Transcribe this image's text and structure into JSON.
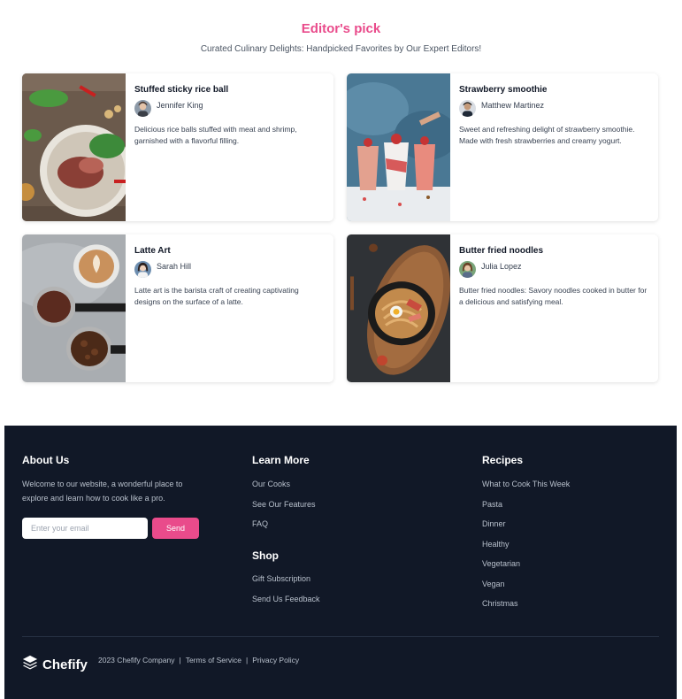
{
  "section": {
    "title": "Editor's pick",
    "subtitle": "Curated Culinary Delights: Handpicked Favorites by Our Expert Editors!"
  },
  "cards": [
    {
      "title": "Stuffed sticky rice ball",
      "author": "Jennifer King",
      "description": "Delicious rice balls stuffed with meat and shrimp, garnished with a flavorful filling."
    },
    {
      "title": "Strawberry smoothie",
      "author": "Matthew Martinez",
      "description": "Sweet and refreshing delight of strawberry smoothie. Made with fresh strawberries and creamy yogurt."
    },
    {
      "title": "Latte Art",
      "author": "Sarah Hill",
      "description": "Latte art is the barista craft of creating captivating designs on the surface of a latte."
    },
    {
      "title": "Butter fried noodles",
      "author": "Julia Lopez",
      "description": "Butter fried noodles: Savory noodles cooked in butter for a delicious and satisfying meal."
    }
  ],
  "footer": {
    "about": {
      "title": "About Us",
      "text": "Welcome to our website, a wonderful place to explore and learn how to cook like a pro.",
      "email_placeholder": "Enter your email",
      "send_label": "Send"
    },
    "learn_more": {
      "title": "Learn More",
      "links": [
        "Our Cooks",
        "See Our Features",
        "FAQ"
      ]
    },
    "shop": {
      "title": "Shop",
      "links": [
        "Gift Subscription",
        "Send Us Feedback"
      ]
    },
    "recipes": {
      "title": "Recipes",
      "links": [
        "What to Cook This Week",
        "Pasta",
        "Dinner",
        "Healthy",
        "Vegetarian",
        "Vegan",
        "Christmas"
      ]
    },
    "brand": "Chefify",
    "copyright": "2023 Chefify Company",
    "terms": "Terms of Service",
    "privacy": "Privacy Policy",
    "separator": "|"
  },
  "colors": {
    "accent": "#e94b8b",
    "footer_bg": "#111827"
  }
}
